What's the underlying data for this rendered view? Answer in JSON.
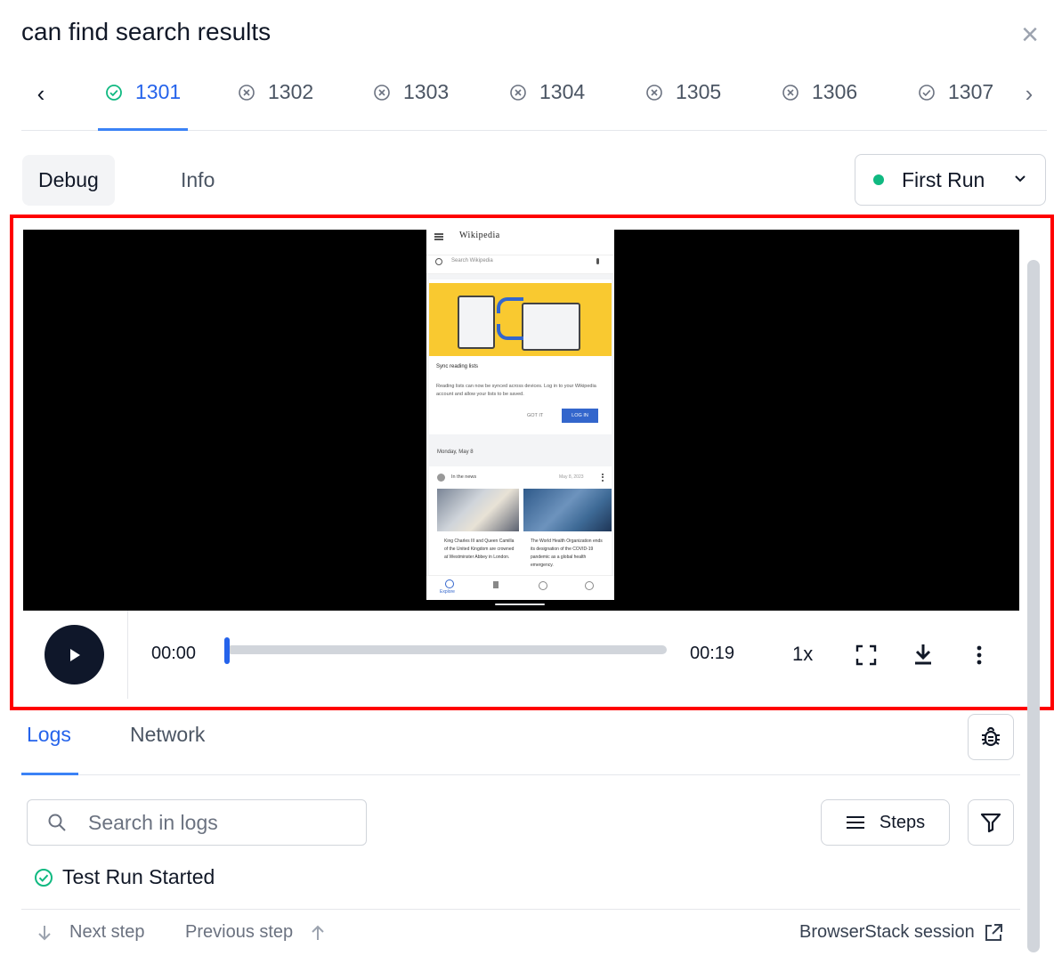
{
  "header": {
    "title": "can find search results"
  },
  "runs": [
    {
      "label": "1301",
      "status": "passed",
      "active": true
    },
    {
      "label": "1302",
      "status": "failed"
    },
    {
      "label": "1303",
      "status": "failed"
    },
    {
      "label": "1304",
      "status": "failed"
    },
    {
      "label": "1305",
      "status": "failed"
    },
    {
      "label": "1306",
      "status": "failed"
    },
    {
      "label": "1307",
      "status": "passed"
    }
  ],
  "modes": {
    "debug": "Debug",
    "info": "Info"
  },
  "run_select": {
    "value": "First Run",
    "status_color": "#10b981"
  },
  "phone": {
    "brand": "Wikipedia",
    "search_placeholder": "Search Wikipedia",
    "card_title": "Sync reading lists",
    "card_body": "Reading lists can now be synced across devices. Log in to your Wikipedia account and allow your lists to be saved.",
    "got_it": "GOT IT",
    "log_in": "LOG IN",
    "date_header": "Monday, May 8",
    "news_label": "In the news",
    "news_date": "May 8, 2023",
    "story1": "King Charles III and Queen Camilla of the United Kingdom are crowned at Westminster Abbey in London.",
    "story2": "The World Health Organization ends its designation of the COVID-19 pandemic as a global health emergency.",
    "nav_explore": "Explore"
  },
  "player": {
    "current": "00:00",
    "duration": "00:19",
    "speed": "1x",
    "progress": 0
  },
  "logs": {
    "tab_logs": "Logs",
    "tab_network": "Network",
    "search_placeholder": "Search in logs",
    "steps_label": "Steps",
    "entry": "Test Run Started",
    "next_step": "Next step",
    "previous_step": "Previous step",
    "session_link": "BrowserStack session"
  },
  "colors": {
    "accent": "#2563eb",
    "passed": "#10b981",
    "highlight": "#ff0000"
  }
}
